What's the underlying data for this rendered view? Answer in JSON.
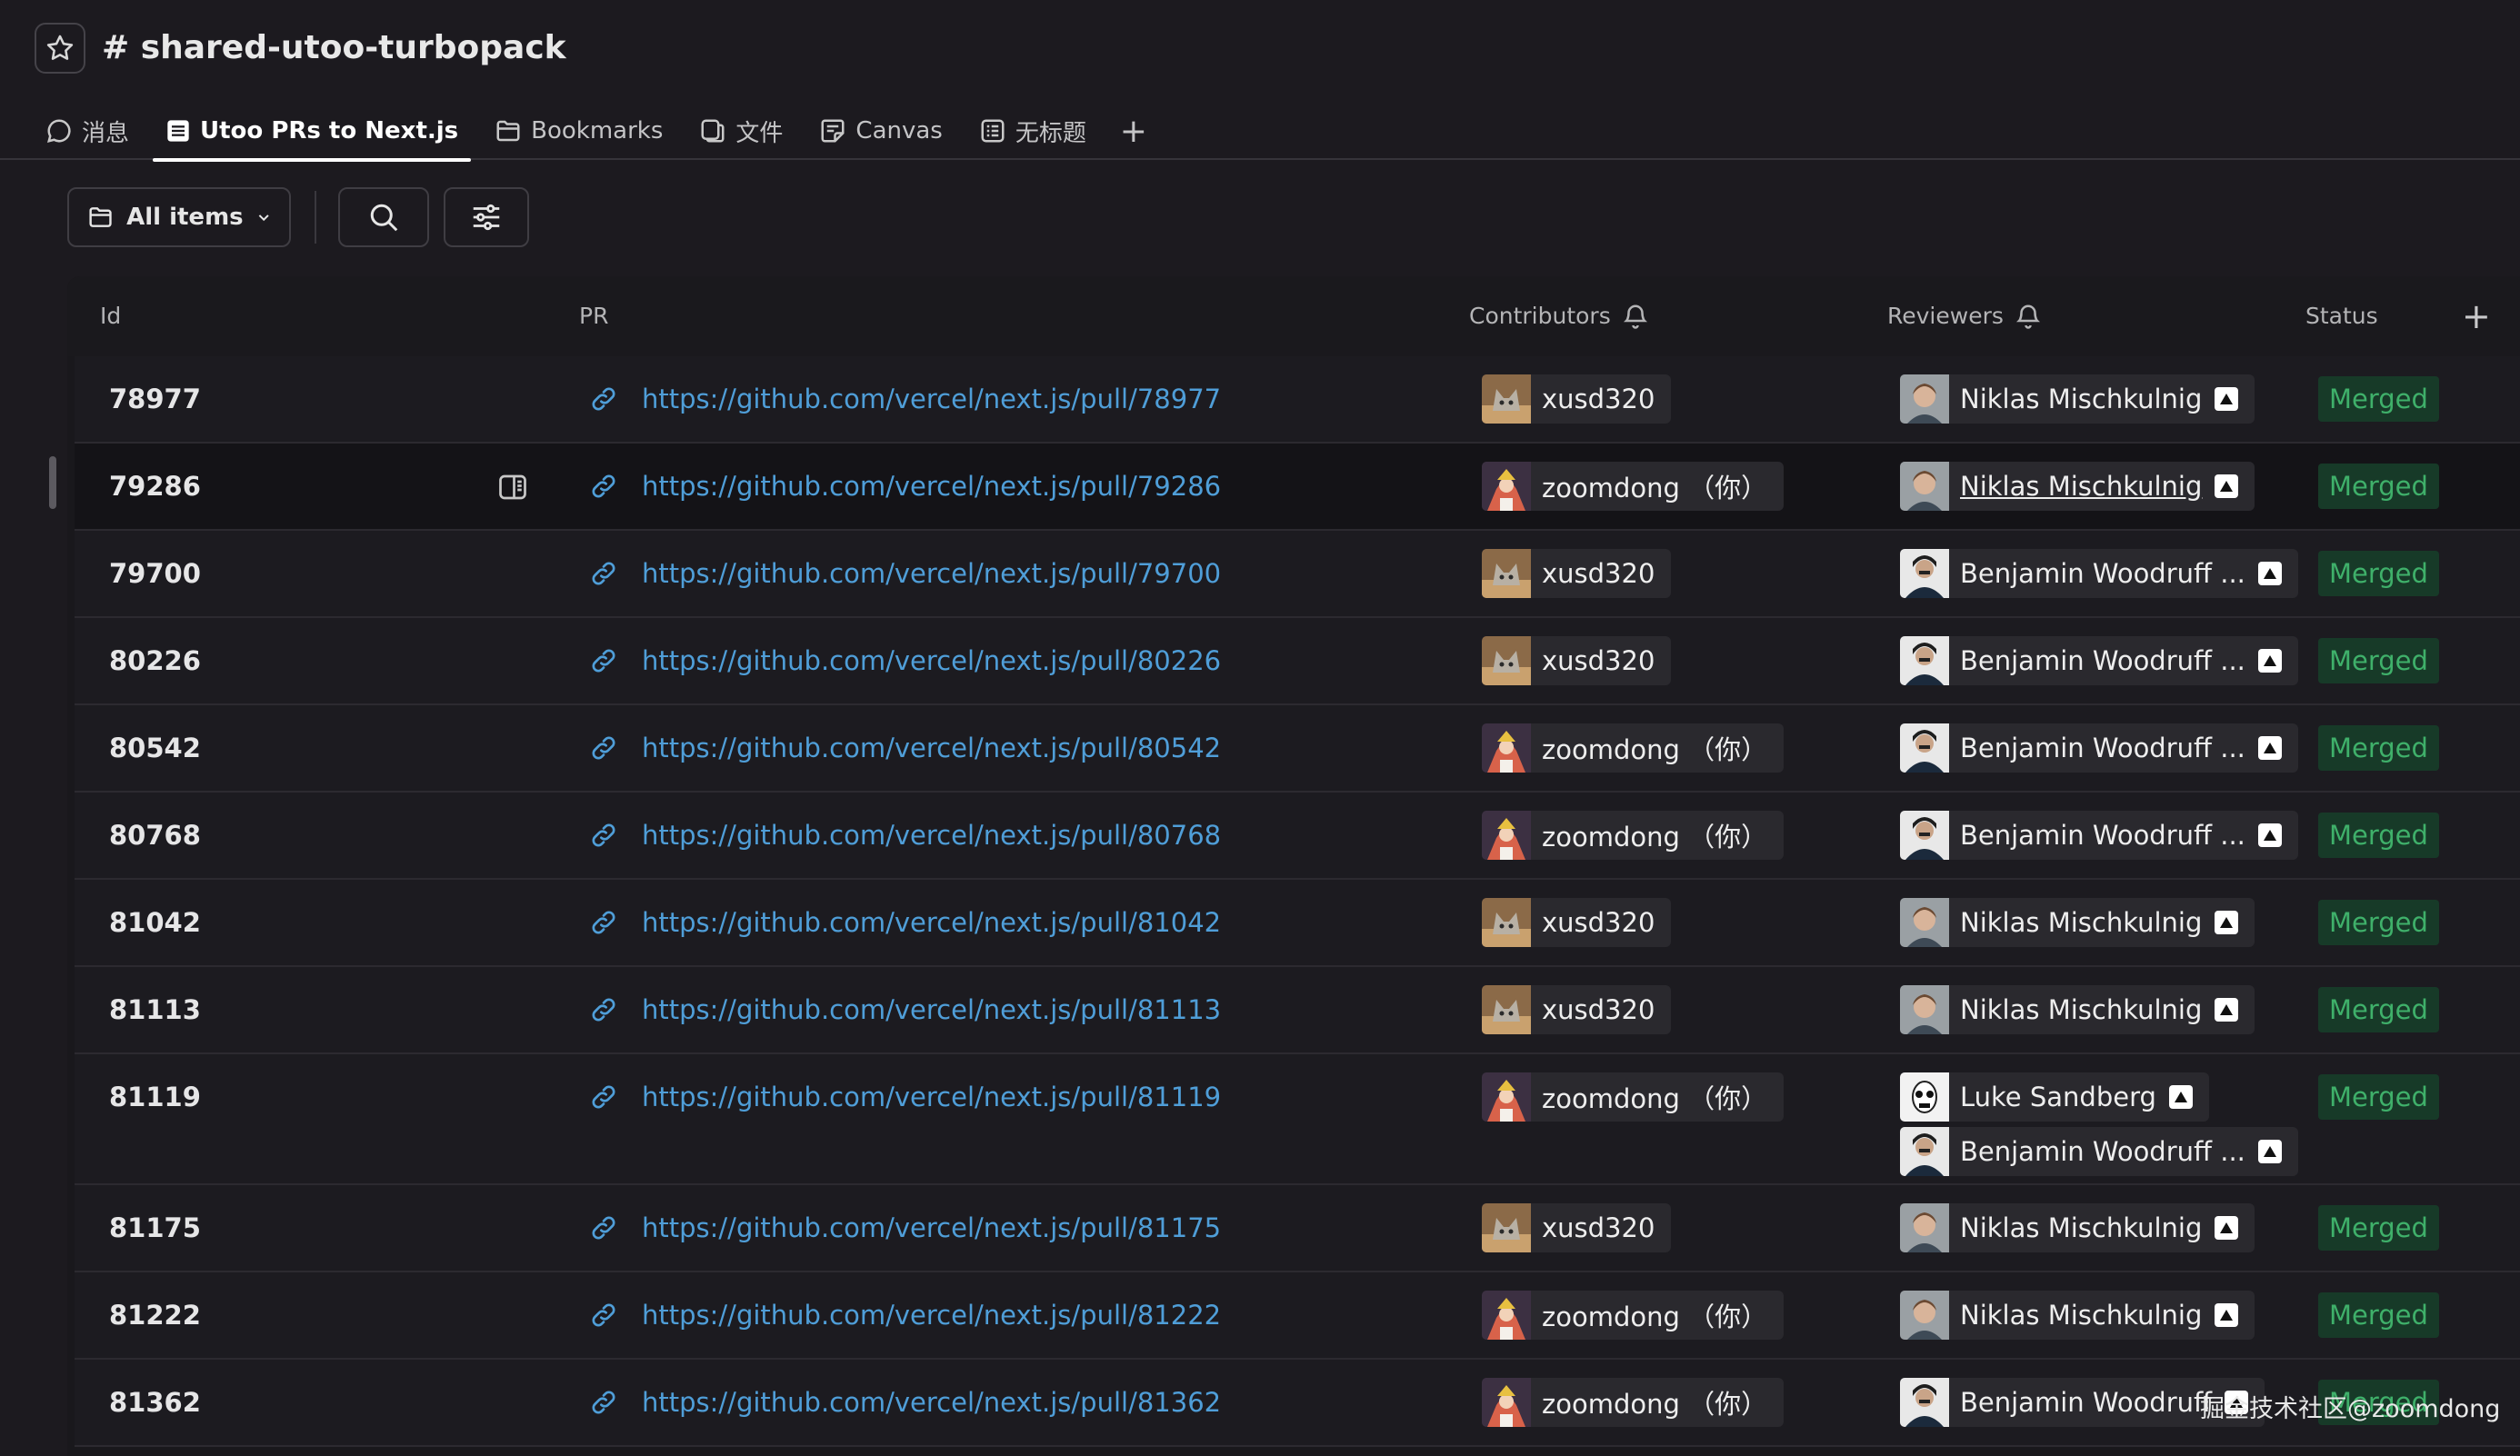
{
  "header": {
    "channel": "# shared-utoo-turbopack"
  },
  "tabs": [
    {
      "label": "消息",
      "icon": "chat-bubble-icon"
    },
    {
      "label": "Utoo PRs to Next.js",
      "icon": "list-icon",
      "active": true
    },
    {
      "label": "Bookmarks",
      "icon": "folder-icon"
    },
    {
      "label": "文件",
      "icon": "files-icon"
    },
    {
      "label": "Canvas",
      "icon": "canvas-icon"
    },
    {
      "label": "无标题",
      "icon": "list-doc-icon"
    }
  ],
  "tab_add_label": "+",
  "toolbar": {
    "view_label": "All items"
  },
  "table": {
    "columns": {
      "id": "Id",
      "pr": "PR",
      "contributors": "Contributors",
      "reviewers": "Reviewers",
      "status": "Status",
      "add": "+"
    },
    "rows": [
      {
        "id": "78977",
        "pr": "https://github.com/vercel/next.js/pull/78977",
        "contributor": "xusd320",
        "reviewers": [
          "Niklas Mischkulnig"
        ],
        "status": "Merged"
      },
      {
        "id": "79286",
        "pr": "https://github.com/vercel/next.js/pull/79286",
        "contributor": "zoomdong （你）",
        "reviewers": [
          "Niklas Mischkulnig"
        ],
        "status": "Merged"
      },
      {
        "id": "79700",
        "pr": "https://github.com/vercel/next.js/pull/79700",
        "contributor": "xusd320",
        "reviewers": [
          "Benjamin Woodruff ..."
        ],
        "status": "Merged"
      },
      {
        "id": "80226",
        "pr": "https://github.com/vercel/next.js/pull/80226",
        "contributor": "xusd320",
        "reviewers": [
          "Benjamin Woodruff ..."
        ],
        "status": "Merged"
      },
      {
        "id": "80542",
        "pr": "https://github.com/vercel/next.js/pull/80542",
        "contributor": "zoomdong （你）",
        "reviewers": [
          "Benjamin Woodruff ..."
        ],
        "status": "Merged"
      },
      {
        "id": "80768",
        "pr": "https://github.com/vercel/next.js/pull/80768",
        "contributor": "zoomdong （你）",
        "reviewers": [
          "Benjamin Woodruff ..."
        ],
        "status": "Merged"
      },
      {
        "id": "81042",
        "pr": "https://github.com/vercel/next.js/pull/81042",
        "contributor": "xusd320",
        "reviewers": [
          "Niklas Mischkulnig"
        ],
        "status": "Merged"
      },
      {
        "id": "81113",
        "pr": "https://github.com/vercel/next.js/pull/81113",
        "contributor": "xusd320",
        "reviewers": [
          "Niklas Mischkulnig"
        ],
        "status": "Merged"
      },
      {
        "id": "81119",
        "pr": "https://github.com/vercel/next.js/pull/81119",
        "contributor": "zoomdong （你）",
        "reviewers": [
          "Luke Sandberg",
          "Benjamin Woodruff ..."
        ],
        "status": "Merged"
      },
      {
        "id": "81175",
        "pr": "https://github.com/vercel/next.js/pull/81175",
        "contributor": "xusd320",
        "reviewers": [
          "Niklas Mischkulnig"
        ],
        "status": "Merged"
      },
      {
        "id": "81222",
        "pr": "https://github.com/vercel/next.js/pull/81222",
        "contributor": "zoomdong （你）",
        "reviewers": [
          "Niklas Mischkulnig"
        ],
        "status": "Merged"
      },
      {
        "id": "81362",
        "pr": "https://github.com/vercel/next.js/pull/81362",
        "contributor": "zoomdong （你）",
        "reviewers": [
          "Benjamin Woodruff"
        ],
        "status": "Merged"
      }
    ]
  },
  "watermark": "掘金技术社区@zoomdong",
  "colors": {
    "background": "#1c1a1f",
    "link": "#4f9ed8",
    "status_bg": "#173a28",
    "status_text": "#3fb06a"
  }
}
